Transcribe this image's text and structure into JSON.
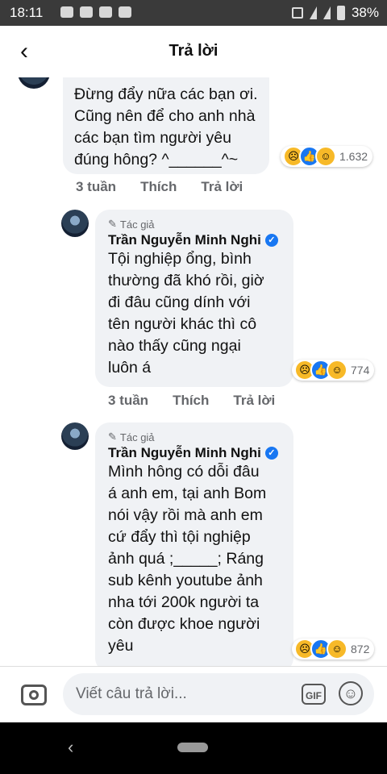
{
  "status": {
    "time": "18:11",
    "battery": "38%"
  },
  "header": {
    "title": "Trả lời"
  },
  "comments": [
    {
      "lines": [
        "Đừng đẩy nữa các bạn ơi.",
        "Cũng nên để cho anh nhà",
        "các bạn tìm người yêu",
        "đúng hông? ^______^~"
      ],
      "reaction_count": "1.632",
      "time": "3 tuần",
      "like_label": "Thích",
      "reply_label": "Trả lời"
    },
    {
      "author_tag": "Tác giả",
      "author": "Trần Nguyễn Minh Nghi",
      "lines": [
        "Tội nghiệp ổng, bình",
        "thường đã khó rồi, giờ",
        "đi đâu cũng dính với",
        "tên người khác thì cô",
        "nào thấy cũng ngại",
        "luôn á"
      ],
      "reaction_count": "774",
      "time": "3 tuần",
      "like_label": "Thích",
      "reply_label": "Trả lời"
    },
    {
      "author_tag": "Tác giả",
      "author": "Trần Nguyễn Minh Nghi",
      "lines": [
        "Mình hông có dỗi đâu",
        "á anh em, tại anh Bom",
        "nói vậy rồi mà anh em",
        "cứ đẩy thì tội nghiệp",
        "ảnh quá ;_____; Ráng",
        "sub kênh youtube ảnh",
        "nha tới 200k người ta",
        "còn được khoe người",
        "yêu"
      ],
      "reaction_count": "872"
    }
  ],
  "compose": {
    "placeholder": "Viết câu trả lời...",
    "gif_label": "GIF"
  }
}
